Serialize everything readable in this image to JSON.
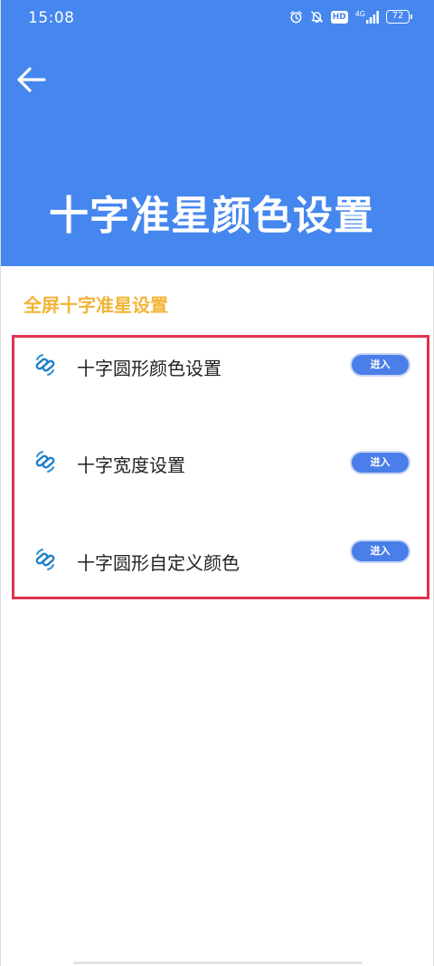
{
  "status_bar": {
    "time": "15:08",
    "hd_label": "HD",
    "network_label": "4G",
    "battery_level": "72",
    "icons": [
      "alarm-icon",
      "mute-bell-icon",
      "hd-icon",
      "signal-icon",
      "battery-icon"
    ]
  },
  "header": {
    "back_icon": "arrow-left-icon",
    "title": "十字准星颜色设置",
    "color": "#4587ee"
  },
  "section": {
    "title": "全屏十字准星设置",
    "title_color": "#f2b437",
    "highlight_color": "#e0334d",
    "items": [
      {
        "label": "十字圆形颜色设置",
        "button_label": "进入",
        "icon": "link-icon"
      },
      {
        "label": "十字宽度设置",
        "button_label": "进入",
        "icon": "link-icon"
      },
      {
        "label": "十字圆形自定义颜色",
        "button_label": "进入",
        "icon": "link-icon"
      }
    ]
  },
  "accent_color": "#4a7ee9"
}
